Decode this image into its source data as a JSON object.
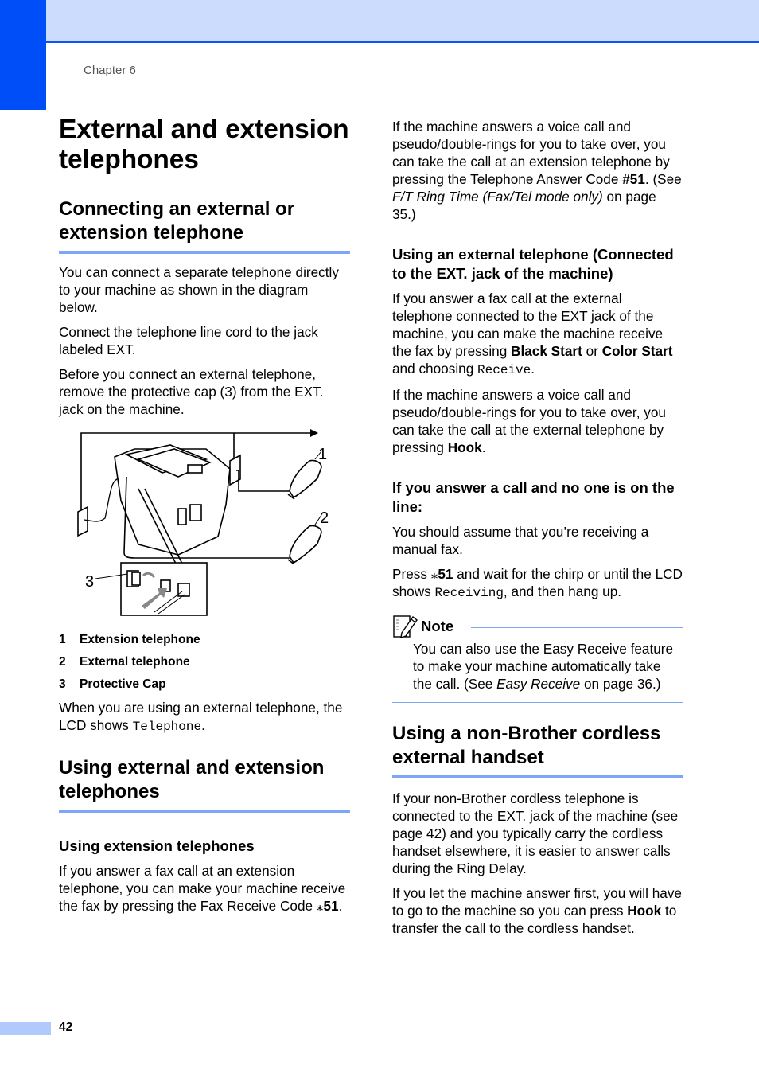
{
  "header": {
    "chapter_label": "Chapter 6",
    "colors": {
      "band": "#ccdcfc",
      "rule": "#0a55f5",
      "side_tab": "#004ef8",
      "heading_rule": "#7ea5f8"
    }
  },
  "left": {
    "title": "External and extension telephones",
    "section1": {
      "heading": "Connecting an external or extension telephone",
      "paragraphs": [
        "You can connect a separate telephone directly to your machine as shown in the diagram below.",
        "Connect the telephone line cord to the jack labeled EXT.",
        "Before you connect an external telephone, remove the protective cap (3) from the EXT. jack on the machine."
      ],
      "diagram": {
        "callouts": [
          "1",
          "2",
          "3"
        ]
      },
      "legend": [
        {
          "num": "1",
          "label": "Extension telephone"
        },
        {
          "num": "2",
          "label": "External telephone"
        },
        {
          "num": "3",
          "label": "Protective Cap"
        }
      ],
      "lcd_text_before": "When you are using an external telephone, the LCD shows ",
      "lcd_value": "Telephone",
      "lcd_text_after": "."
    },
    "section2": {
      "heading": "Using external and extension telephones",
      "sub_heading": "Using extension telephones",
      "para_before": "If you answer a fax call at an extension telephone, you can make your machine receive the fax by pressing the Fax Receive Code ",
      "code_star": "⁎",
      "code_num": "51",
      "para_after": "."
    }
  },
  "right": {
    "p1_before": "If the machine answers a voice call and pseudo/double-rings for you to take over, you can take the call at an extension telephone by pressing the Telephone Answer Code ",
    "p1_code": "#51",
    "p1_mid": ". (See ",
    "p1_ref": "F/T Ring Time (Fax/Tel mode only)",
    "p1_after": " on page 35.)",
    "ext_heading": "Using an external telephone (Connected to the EXT. jack of the machine)",
    "ext_p1_before": "If you answer a fax call at the external telephone connected to the EXT jack of the machine, you can make the machine receive the fax by pressing ",
    "ext_p1_key1": "Black Start",
    "ext_p1_or": " or ",
    "ext_p1_key2": "Color Start",
    "ext_p1_mid": " and choosing ",
    "ext_p1_lcd": "Receive",
    "ext_p1_after": ".",
    "ext_p2_before": "If the machine answers a voice call and pseudo/double-rings for you to take over, you can take the call at the external telephone by pressing ",
    "ext_p2_key": "Hook",
    "ext_p2_after": ".",
    "noone_heading": "If you answer a call and no one is on the line:",
    "noone_p1": "You should assume that you’re receiving a manual fax.",
    "noone_p2_before": "Press ",
    "noone_p2_star": "⁎",
    "noone_p2_code": "51",
    "noone_p2_mid": " and wait for the chirp or until the LCD shows ",
    "noone_p2_lcd": "Receiving",
    "noone_p2_after": ", and then hang up.",
    "note": {
      "icon": "note-pencil-icon",
      "title": "Note",
      "body_before": "You can also use the Easy Receive feature to make your machine automatically take the call. (See ",
      "body_ref": "Easy Receive",
      "body_after": " on page 36.)"
    },
    "cordless": {
      "heading": "Using a non-Brother cordless external handset",
      "p1": "If your non-Brother cordless telephone is connected to the EXT. jack of the machine (see page 42) and you typically carry the cordless handset elsewhere, it is easier to answer calls during the Ring Delay.",
      "p2_before": "If you let the machine answer first, you will have to go to the machine so you can press ",
      "p2_key": "Hook",
      "p2_after": " to transfer the call to the cordless handset."
    }
  },
  "footer": {
    "page_number": "42"
  }
}
